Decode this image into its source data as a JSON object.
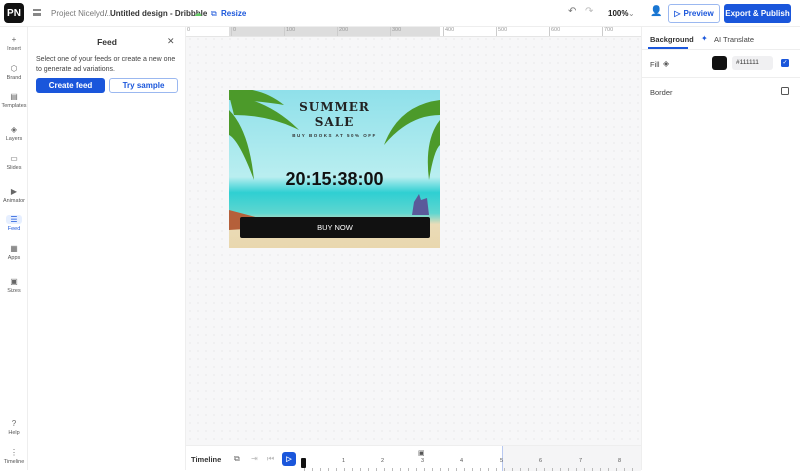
{
  "topbar": {
    "logo": "PN",
    "project": "Project Nicelyd...",
    "separator": "/",
    "design_title": "Untitled design - Dribbble",
    "resize": "Resize",
    "zoom": "100%",
    "preview": "Preview",
    "export": "Export & Publish"
  },
  "rail": {
    "items": [
      {
        "label": "Insert",
        "icon": "plus-icon"
      },
      {
        "label": "Brand",
        "icon": "brand-icon"
      },
      {
        "label": "Templates",
        "icon": "templates-icon"
      },
      {
        "label": "Layers",
        "icon": "layers-icon"
      },
      {
        "label": "Slides",
        "icon": "slides-icon"
      },
      {
        "label": "Animator",
        "icon": "animator-icon"
      },
      {
        "label": "Feed",
        "icon": "feed-icon"
      },
      {
        "label": "Apps",
        "icon": "apps-icon"
      },
      {
        "label": "Sizes",
        "icon": "sizes-icon"
      }
    ],
    "help": "Help",
    "timeline": "Timeline"
  },
  "feed": {
    "title": "Feed",
    "description": "Select one of your feeds or create a new one to generate ad variations.",
    "create": "Create feed",
    "try": "Try sample"
  },
  "ruler": {
    "labels": [
      "0",
      "0",
      "100",
      "200",
      "300",
      "400",
      "500",
      "600",
      "700"
    ]
  },
  "design": {
    "title1": "SUMMER",
    "title2": "SALE",
    "subtitle": "BUY BOOKS AT 50% OFF",
    "countdown": "20:15:38:00",
    "cta": "BUY NOW"
  },
  "right": {
    "tab_background": "Background",
    "tab_translate": "AI Translate",
    "fill_label": "Fill",
    "fill_color": "#111111",
    "fill_hex": "#111111",
    "border_label": "Border"
  },
  "timeline": {
    "label": "Timeline",
    "ticks": [
      "1",
      "2",
      "3",
      "4",
      "5",
      "6",
      "7",
      "8"
    ]
  },
  "colors": {
    "accent": "#1a56db"
  }
}
